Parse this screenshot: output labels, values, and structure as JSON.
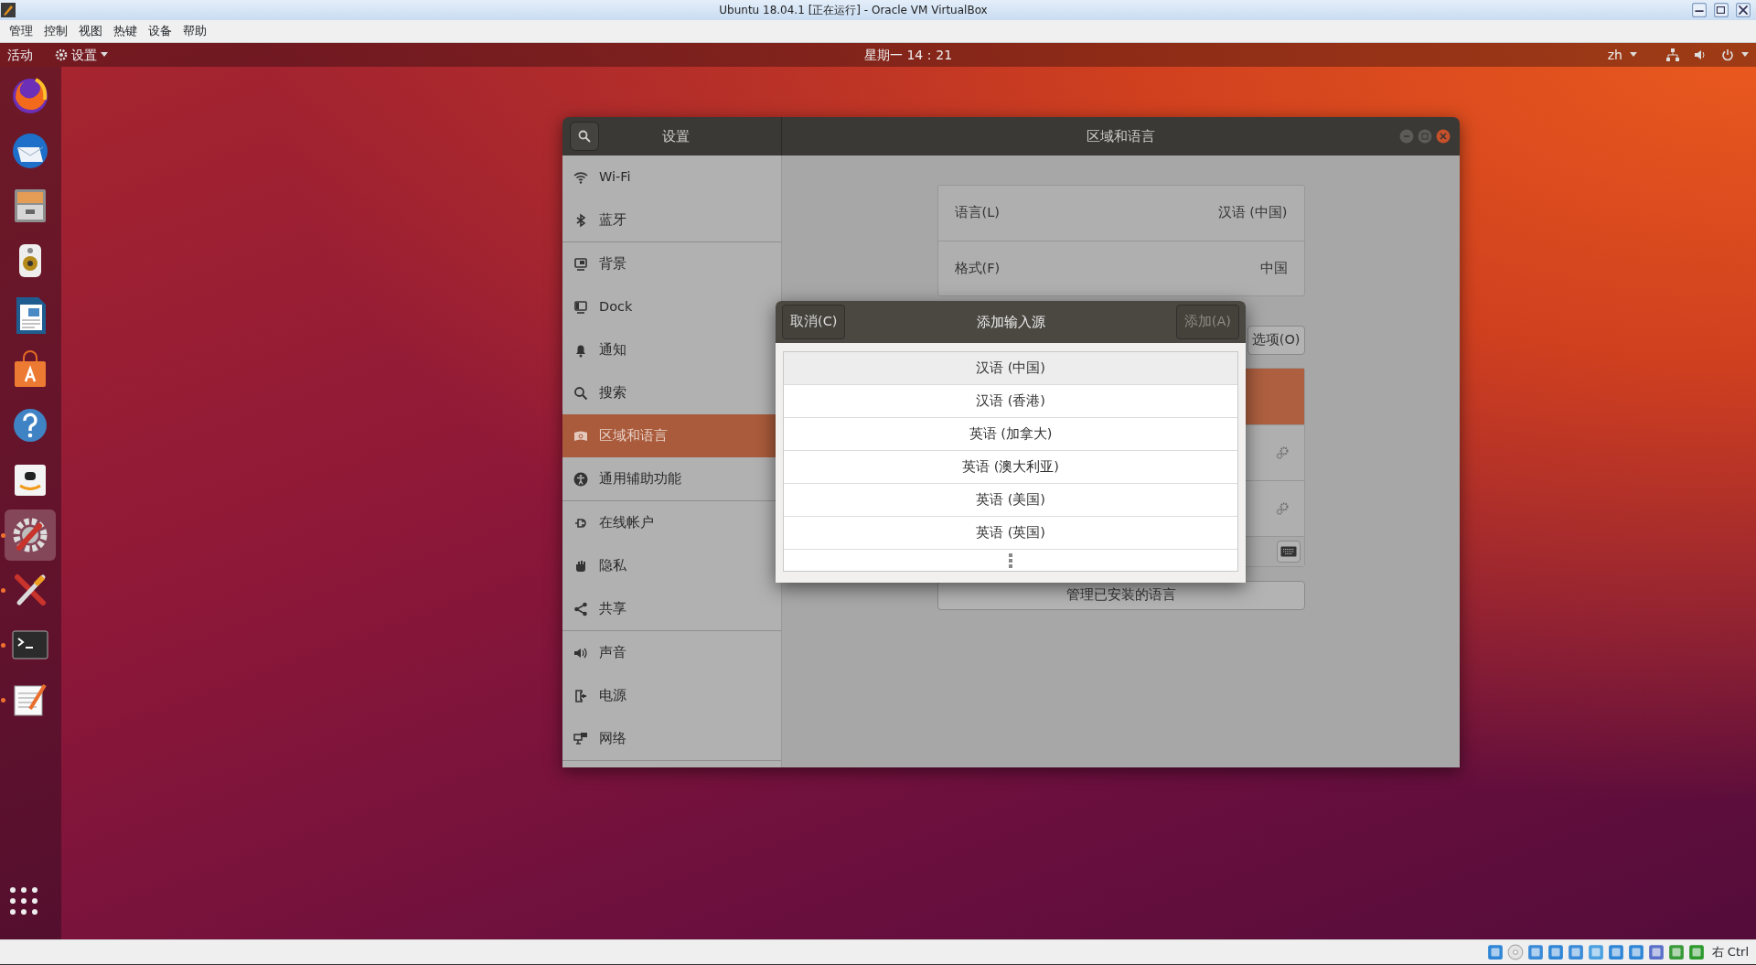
{
  "vbox_window": {
    "title": "Ubuntu 18.04.1 [正在运行] - Oracle VM VirtualBox"
  },
  "vbox_menu": [
    "管理",
    "控制",
    "视图",
    "热键",
    "设备",
    "帮助"
  ],
  "top_bar": {
    "activities": "活动",
    "app_menu": "设置",
    "clock": "星期一 14：21",
    "input_method": "zh"
  },
  "dock": [
    {
      "kind": "firefox",
      "running": false,
      "selected": false
    },
    {
      "kind": "mail",
      "running": false,
      "selected": false
    },
    {
      "kind": "files",
      "running": false,
      "selected": false
    },
    {
      "kind": "speaker",
      "running": false,
      "selected": false
    },
    {
      "kind": "document",
      "running": false,
      "selected": false
    },
    {
      "kind": "store",
      "running": false,
      "selected": false
    },
    {
      "kind": "help",
      "running": false,
      "selected": false
    },
    {
      "kind": "shop",
      "running": false,
      "selected": false
    },
    {
      "kind": "settings",
      "running": true,
      "selected": true
    },
    {
      "kind": "tools",
      "running": true,
      "selected": false
    },
    {
      "kind": "terminal",
      "running": true,
      "selected": false
    },
    {
      "kind": "editor",
      "running": true,
      "selected": false
    }
  ],
  "settings": {
    "title": "设置",
    "panel_title": "区域和语言",
    "sidebar_groups": [
      [
        {
          "label": "Wi-Fi",
          "kind": "wifi",
          "selected": false
        },
        {
          "label": "蓝牙",
          "kind": "bluetooth",
          "selected": false
        }
      ],
      [
        {
          "label": "背景",
          "kind": "background",
          "selected": false
        },
        {
          "label": "Dock",
          "kind": "dock",
          "selected": false
        },
        {
          "label": "通知",
          "kind": "bell",
          "selected": false
        },
        {
          "label": "搜索",
          "kind": "search",
          "selected": false
        },
        {
          "label": "区域和语言",
          "kind": "region",
          "selected": true
        },
        {
          "label": "通用辅助功能",
          "kind": "accessibility",
          "selected": false
        }
      ],
      [
        {
          "label": "在线帐户",
          "kind": "online",
          "selected": false
        },
        {
          "label": "隐私",
          "kind": "privacy",
          "selected": false
        },
        {
          "label": "共享",
          "kind": "share",
          "selected": false
        }
      ],
      [
        {
          "label": "声音",
          "kind": "sound",
          "selected": false
        },
        {
          "label": "电源",
          "kind": "power",
          "selected": false
        },
        {
          "label": "网络",
          "kind": "network",
          "selected": false
        }
      ]
    ],
    "language_rows": [
      {
        "label": "语言(L)",
        "value": "汉语 (中国)"
      },
      {
        "label": "格式(F)",
        "value": "中国"
      }
    ],
    "options_button": "选项(O)",
    "input_sources": [
      {
        "selected": true,
        "settings_button": false
      },
      {
        "selected": false,
        "settings_button": true
      },
      {
        "selected": false,
        "settings_button": true
      }
    ],
    "manage_button": "管理已安装的语言"
  },
  "dialog": {
    "title": "添加输入源",
    "cancel": "取消(C)",
    "add": "添加(A)",
    "add_disabled": true,
    "items": [
      {
        "label": "汉语 (中国)",
        "selected": true
      },
      {
        "label": "汉语 (香港)",
        "selected": false
      },
      {
        "label": "英语 (加拿大)",
        "selected": false
      },
      {
        "label": "英语 (澳大利亚)",
        "selected": false
      },
      {
        "label": "英语 (美国)",
        "selected": false
      },
      {
        "label": "英语 (英国)",
        "selected": false
      }
    ]
  },
  "status_bar": {
    "host_key": "右 Ctrl"
  }
}
